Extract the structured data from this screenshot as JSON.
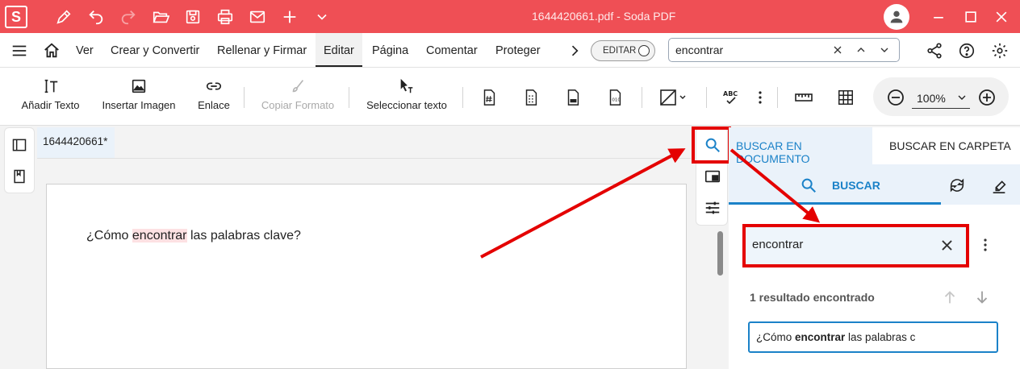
{
  "window": {
    "logo_letter": "S",
    "title": "1644420661.pdf  -  Soda PDF"
  },
  "menu": {
    "items": [
      "Ver",
      "Crear y Convertir",
      "Rellenar y Firmar",
      "Editar",
      "Página",
      "Comentar",
      "Proteger"
    ],
    "active": "Editar",
    "editar_toggle": "EDITAR",
    "search_value": "encontrar"
  },
  "toolbar": {
    "add_text": "Añadir Texto",
    "insert_image": "Insertar Imagen",
    "link": "Enlace",
    "copy_format": "Copiar Formato",
    "select_text": "Seleccionar texto",
    "zoom": "100%"
  },
  "document": {
    "tab_name": "1644420661*",
    "text_before": "¿Cómo ",
    "text_highlight": "encontrar",
    "text_after": " las palabras clave?"
  },
  "search_panel": {
    "tab_document": "BUSCAR EN DOCUMENTO",
    "tab_folder": "BUSCAR EN CARPETA",
    "sub_label": "BUSCAR",
    "query": "encontrar",
    "result_count": "1 resultado encontrado",
    "result_before": "¿Cómo ",
    "result_match": "encontrar",
    "result_after": " las palabras c"
  },
  "colors": {
    "titlebar": "#ef4f55",
    "accent": "#1b82c8",
    "annotation": "#e40000"
  }
}
